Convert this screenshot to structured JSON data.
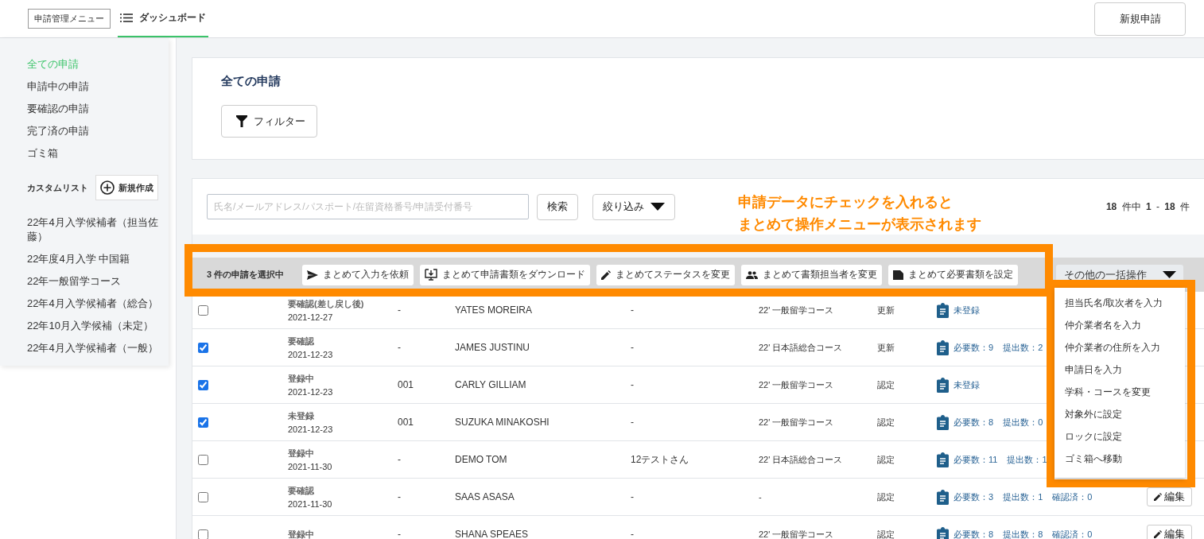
{
  "topbar": {
    "menu_label": "申請管理メニュー",
    "tabs": [
      {
        "label": "ダッシュボード",
        "selected": true
      }
    ],
    "new_button": "新規申請"
  },
  "sidebar": {
    "items": [
      {
        "label": "全ての申請",
        "selected": true
      },
      {
        "label": "申請中の申請",
        "selected": false
      },
      {
        "label": "要確認の申請",
        "selected": false
      },
      {
        "label": "完了済の申請",
        "selected": false
      },
      {
        "label": "ゴミ箱",
        "selected": false
      }
    ],
    "custom_list_title": "カスタムリスト",
    "new_list_button": "新規作成",
    "custom_lists": [
      "22年4月入学候補者（担当佐藤）",
      "22年度4月入学 中国籍",
      "22年一般留学コース",
      "22年4月入学候補者（総合）",
      "22年10月入学候補（未定）",
      "22年4月入学候補者（一般）"
    ]
  },
  "summary": {
    "title": "全ての申請",
    "filter_button": "フィルター"
  },
  "toolbar": {
    "search": {
      "placeholder": "氏名/メールアドレス/パスポート/在留資格番号/申請受付番号"
    },
    "search_button": "検索",
    "narrow_button": "絞り込み",
    "pagination": "**18** 件中 **1** - **18** 件"
  },
  "bulk_bar": {
    "selected_text": "3 件の申請を選択中",
    "actions": [
      {
        "kind": "send",
        "label": "まとめて入力を依頼"
      },
      {
        "kind": "download",
        "label": "まとめて申請書類をダウンロード"
      },
      {
        "kind": "edit",
        "label": "まとめてステータスを変更"
      },
      {
        "kind": "people",
        "label": "まとめて書類担当者を変更"
      },
      {
        "kind": "document",
        "label": "まとめて必要書類を設定"
      }
    ],
    "more_button": "その他の一括操作",
    "more_expanded": true,
    "more_menu": [
      "担当氏名/取次者を入力",
      "仲介業者名を入力",
      "仲介業者の住所を入力",
      "申請日を入力",
      "学科・コースを変更",
      "対象外に設定",
      "ロックに設定",
      "ゴミ箱へ移動"
    ]
  },
  "table": {
    "rows": [
      {
        "checked": false,
        "status": "要確認(差し戻し後)",
        "date": "2021-12-27",
        "number": "-",
        "name": "YATES MOREIRA",
        "nickname": "-",
        "course": "22' 一般留学コース",
        "type": "更新",
        "docs": [
          "未登録"
        ]
      },
      {
        "checked": true,
        "status": "要確認",
        "date": "2021-12-23",
        "number": "-",
        "name": "JAMES JUSTINU",
        "nickname": "-",
        "course": "22' 日本語総合コース",
        "type": "更新",
        "docs": [
          "必要数：9",
          "提出数：2"
        ]
      },
      {
        "checked": true,
        "status": "登録中",
        "date": "2021-12-23",
        "number": "001",
        "name": "CARLY GILLIAM",
        "nickname": "-",
        "course": "22' 一般留学コース",
        "type": "認定",
        "docs": [
          "未登録"
        ]
      },
      {
        "checked": true,
        "status": "未登録",
        "date": "2021-12-23",
        "number": "001",
        "name": "SUZUKA MINAKOSHI",
        "nickname": "-",
        "course": "22' 一般留学コース",
        "type": "認定",
        "docs": [
          "必要数：8",
          "提出数：0"
        ]
      },
      {
        "checked": false,
        "status": "登録中",
        "date": "2021-11-30",
        "number": "-",
        "name": "DEMO TOM",
        "nickname": "12テストさん",
        "course": "22' 日本語総合コース",
        "type": "認定",
        "docs": [
          "必要数：11",
          "提出数：1"
        ]
      },
      {
        "checked": false,
        "status": "要確認",
        "date": "2021-11-30",
        "number": "-",
        "name": "SAAS ASASA",
        "nickname": "-",
        "course": "-",
        "type": "認定",
        "docs": [
          "必要数：3",
          "提出数：1",
          "確認済：0"
        ],
        "edit_button": "編集"
      },
      {
        "checked": false,
        "status": "登録中",
        "number": "-",
        "name": "SHANA SPEAES",
        "nickname": "-",
        "course": "22' 一般留学コース",
        "type": "認定",
        "docs": [
          "必要数：8",
          "提出数：8",
          "確認済：0"
        ],
        "edit_button": "編集"
      }
    ]
  },
  "callout": [
    "申請データにチェックを入れると",
    "まとめて操作メニューが表示されます"
  ]
}
